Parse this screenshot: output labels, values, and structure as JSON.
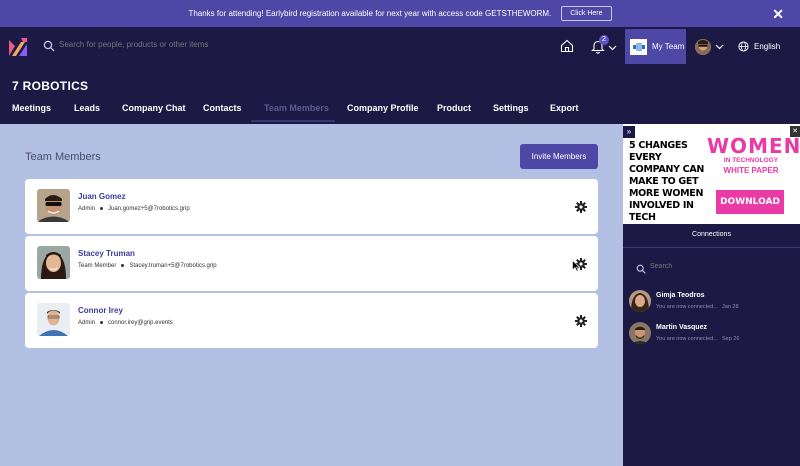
{
  "banner": {
    "message": "Thanks for attending! Earlybird registration available for next year with access code GETSTHEWORM.",
    "button": "Click Here",
    "close": "✕"
  },
  "topnav": {
    "search_placeholder": "Search for people, products or other items",
    "notification_count": "2",
    "my_team_label": "My Team",
    "language": "English"
  },
  "company": {
    "title": "7 ROBOTICS",
    "tabs": [
      {
        "label": "Meetings"
      },
      {
        "label": "Leads"
      },
      {
        "label": "Company Chat"
      },
      {
        "label": "Contacts"
      },
      {
        "label": "Team Members"
      },
      {
        "label": "Company Profile"
      },
      {
        "label": "Product"
      },
      {
        "label": "Settings"
      },
      {
        "label": "Export"
      }
    ],
    "active_tab": "Team Members"
  },
  "main": {
    "section_title": "Team Members",
    "invite_button": "Invite Members",
    "members": [
      {
        "name": "Juan Gomez",
        "role": "Admin",
        "email": "Juan.gomez+5@7robotics.grip"
      },
      {
        "name": "Stacey Truman",
        "role": "Team Member",
        "email": "Stacey.truman+5@7robotics.grip"
      },
      {
        "name": "Connor Irey",
        "role": "Admin",
        "email": "connor.irey@grip.events"
      }
    ]
  },
  "ad": {
    "expand": "»",
    "close": "✕",
    "headline": "5 CHANGES EVERY COMPANY CAN MAKE TO GET MORE WOMEN INVOLVED IN TECH",
    "women": "WOMEN",
    "in_tech": "IN TECHNOLOGY",
    "paper": "WHITE PAPER",
    "cta": "DOWNLOAD NOW",
    "accent": "#e93aa5"
  },
  "connections": {
    "header": "Connections",
    "search_placeholder": "Search",
    "items": [
      {
        "name": "Gimja Teodros",
        "message": "You are now connected...",
        "date": "Jan 28"
      },
      {
        "name": "Martin Vasquez",
        "message": "You are now connected...",
        "date": "Sep 26"
      }
    ]
  },
  "colors": {
    "nav_bg": "#1c1a45",
    "accent": "#4d47a6",
    "main_bg": "#b2c1e3"
  }
}
